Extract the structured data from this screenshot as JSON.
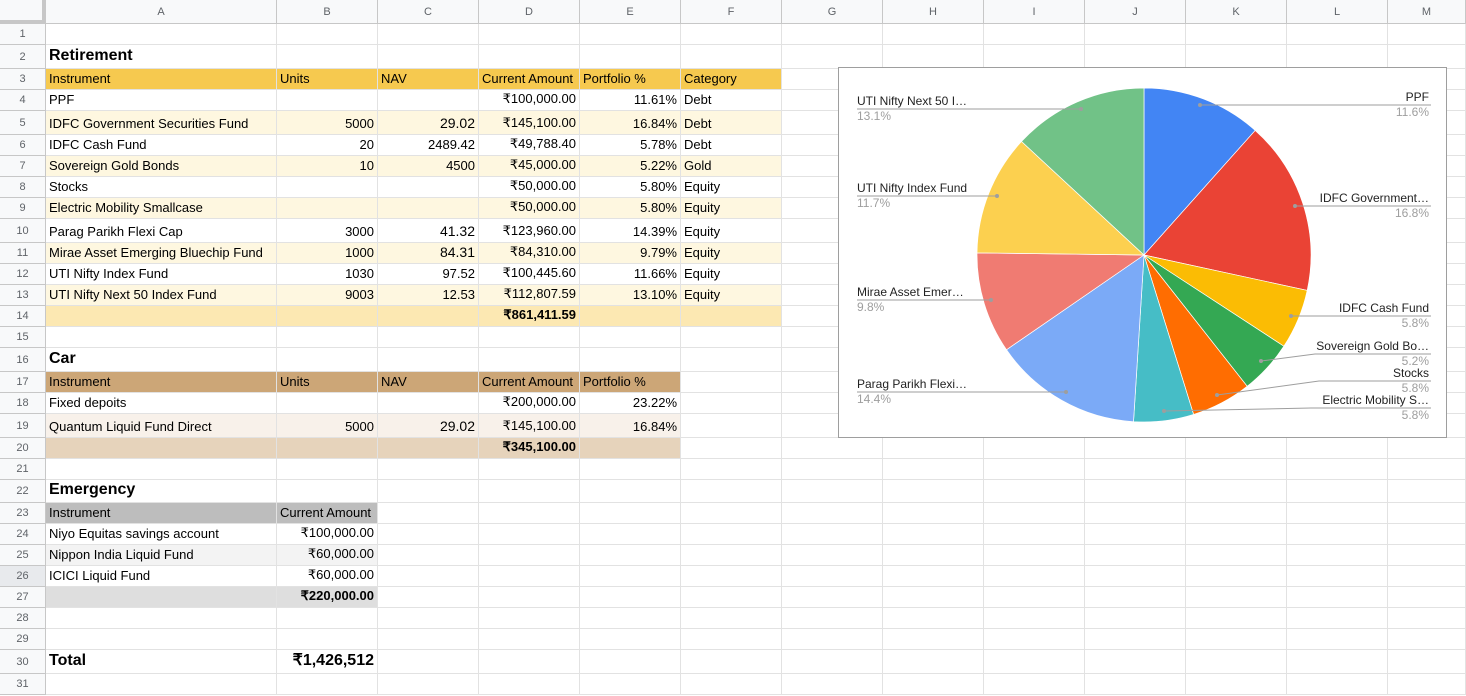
{
  "columns": [
    "A",
    "B",
    "C",
    "D",
    "E",
    "F",
    "G",
    "H",
    "I",
    "J",
    "K",
    "L",
    "M"
  ],
  "row_count": 31,
  "retirement": {
    "title": "Retirement",
    "headers": [
      "Instrument",
      "Units",
      "NAV",
      "Current Amount",
      "Portfolio %",
      "Category"
    ],
    "rows": [
      [
        "PPF",
        "",
        "",
        "₹100,000.00",
        "11.61%",
        "Debt"
      ],
      [
        "IDFC Government Securities Fund",
        "5000",
        "29.02",
        "₹145,100.00",
        "16.84%",
        "Debt"
      ],
      [
        "IDFC Cash Fund",
        "20",
        "2489.42",
        "₹49,788.40",
        "5.78%",
        "Debt"
      ],
      [
        "Sovereign Gold Bonds",
        "10",
        "4500",
        "₹45,000.00",
        "5.22%",
        "Gold"
      ],
      [
        "Stocks",
        "",
        "",
        "₹50,000.00",
        "5.80%",
        "Equity"
      ],
      [
        "Electric Mobility Smallcase",
        "",
        "",
        "₹50,000.00",
        "5.80%",
        "Equity"
      ],
      [
        "Parag Parikh Flexi Cap",
        "3000",
        "41.32",
        "₹123,960.00",
        "14.39%",
        "Equity"
      ],
      [
        "Mirae Asset Emerging Bluechip Fund",
        "1000",
        "84.31",
        "₹84,310.00",
        "9.79%",
        "Equity"
      ],
      [
        "UTI Nifty Index Fund",
        "1030",
        "97.52",
        "₹100,445.60",
        "11.66%",
        "Equity"
      ],
      [
        "UTI Nifty Next 50 Index Fund",
        "9003",
        "12.53",
        "₹112,807.59",
        "13.10%",
        "Equity"
      ]
    ],
    "total": "₹861,411.59"
  },
  "car": {
    "title": "Car",
    "headers": [
      "Instrument",
      "Units",
      "NAV",
      "Current Amount",
      "Portfolio %"
    ],
    "rows": [
      [
        "Fixed depoits",
        "",
        "",
        "₹200,000.00",
        "23.22%"
      ],
      [
        "Quantum Liquid Fund Direct",
        "5000",
        "29.02",
        "₹145,100.00",
        "16.84%"
      ]
    ],
    "total": "₹345,100.00"
  },
  "emergency": {
    "title": "Emergency",
    "headers": [
      "Instrument",
      "Current Amount"
    ],
    "rows": [
      [
        "Niyo Equitas savings account",
        "₹100,000.00"
      ],
      [
        "Nippon India Liquid Fund",
        "₹60,000.00"
      ],
      [
        "ICICI Liquid Fund",
        "₹60,000.00"
      ]
    ],
    "total": "₹220,000.00"
  },
  "grand_total": {
    "label": "Total",
    "value": "₹1,426,512"
  },
  "chart_data": {
    "type": "pie",
    "title": "",
    "slices": [
      {
        "label": "PPF",
        "value": 11.6,
        "display": "11.6%",
        "color": "#4285f4"
      },
      {
        "label": "IDFC Government…",
        "value": 16.8,
        "display": "16.8%",
        "color": "#ea4335"
      },
      {
        "label": "IDFC Cash Fund",
        "value": 5.8,
        "display": "5.8%",
        "color": "#fbbc04"
      },
      {
        "label": "Sovereign Gold Bo…",
        "value": 5.2,
        "display": "5.2%",
        "color": "#34a853"
      },
      {
        "label": "Stocks",
        "value": 5.8,
        "display": "5.8%",
        "color": "#ff6d01"
      },
      {
        "label": "Electric Mobility S…",
        "value": 5.8,
        "display": "5.8%",
        "color": "#46bdc6"
      },
      {
        "label": "Parag Parikh Flexi…",
        "value": 14.4,
        "display": "14.4%",
        "color": "#7baaf7"
      },
      {
        "label": "Mirae Asset Emer…",
        "value": 9.8,
        "display": "9.8%",
        "color": "#f07b72"
      },
      {
        "label": "UTI Nifty Index Fund",
        "value": 11.7,
        "display": "11.7%",
        "color": "#fcd04f"
      },
      {
        "label": "UTI Nifty Next 50 I…",
        "value": 13.1,
        "display": "13.1%",
        "color": "#71c287"
      }
    ],
    "legend": "labels-with-leader-lines"
  }
}
